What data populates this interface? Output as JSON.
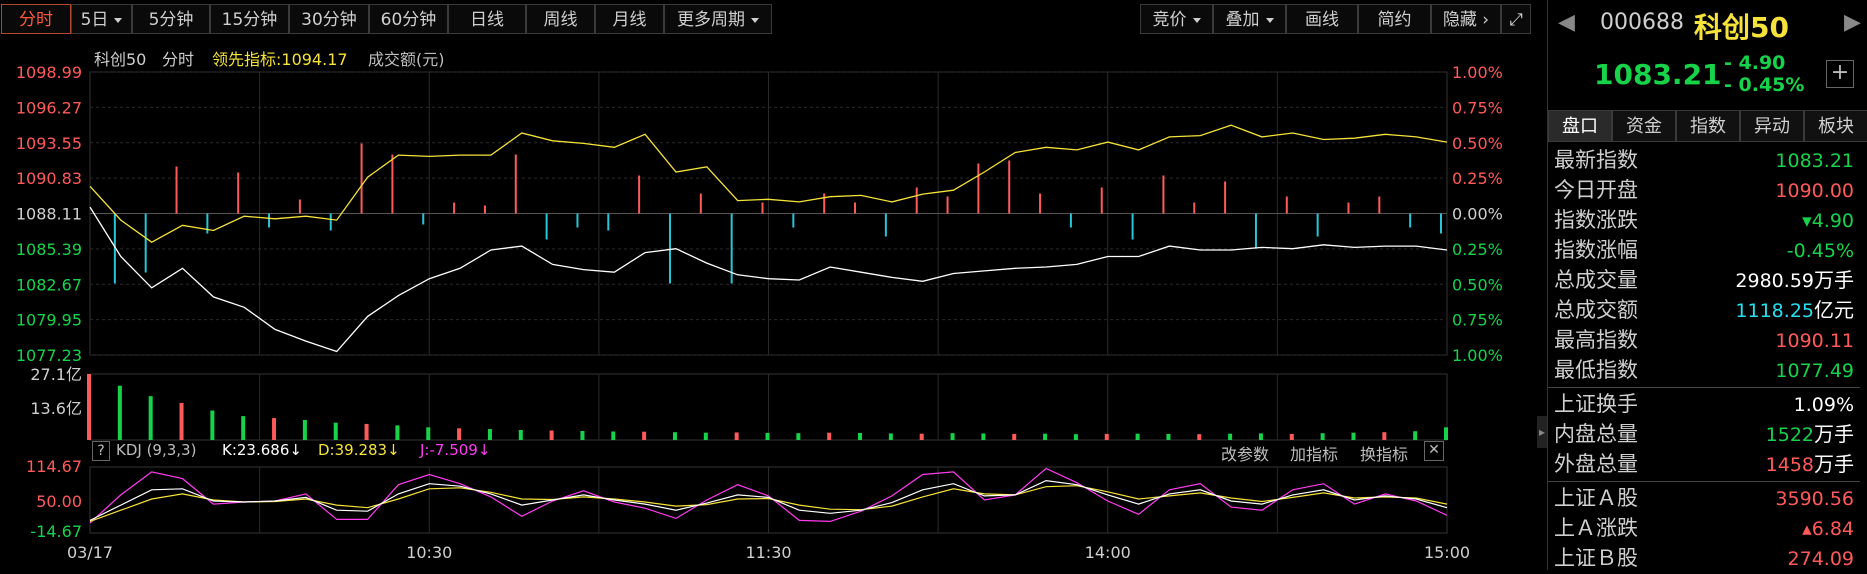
{
  "toolbar": {
    "tabs": [
      "分时",
      "5日",
      "5分钟",
      "15分钟",
      "30分钟",
      "60分钟",
      "日线",
      "周线",
      "月线",
      "更多周期"
    ],
    "right": [
      "竞价",
      "叠加",
      "画线",
      "简约",
      "隐藏"
    ]
  },
  "legend": {
    "name": "科创50",
    "period": "分时",
    "lead_label": "领先指标:1094.17",
    "amount_label": "成交额(元)"
  },
  "price_axis_left": [
    "1098.99",
    "1096.27",
    "1093.55",
    "1090.83",
    "1088.11",
    "1085.39",
    "1082.67",
    "1079.95",
    "1077.23"
  ],
  "price_axis_right": [
    "1.00%",
    "0.75%",
    "0.50%",
    "0.25%",
    "0.00%",
    "0.25%",
    "0.50%",
    "0.75%",
    "1.00%"
  ],
  "volume_axis": [
    "27.1亿",
    "13.6亿"
  ],
  "kdj": {
    "help": "?",
    "title": "KDJ (9,3,3)",
    "k": "K:23.686↓",
    "d": "D:39.283↓",
    "j": "J:-7.509↓",
    "buttons": [
      "改参数",
      "加指标",
      "换指标"
    ],
    "axis": [
      "114.67",
      "50.00",
      "-14.67"
    ]
  },
  "time_axis": [
    "03/17",
    "10:30",
    "11:30",
    "14:00",
    "15:00"
  ],
  "panel": {
    "code": "000688",
    "name": "科创50",
    "price": "1083.21",
    "change": "- 4.90",
    "change_pct": "- 0.45%",
    "tabs": [
      "盘口",
      "资金",
      "指数",
      "异动",
      "板块"
    ],
    "rows": [
      {
        "k": "最新指数",
        "v": "1083.21",
        "c": "green",
        "u": ""
      },
      {
        "k": "今日开盘",
        "v": "1090.00",
        "c": "red",
        "u": ""
      },
      {
        "k": "指数涨跌",
        "v": "▾4.90",
        "c": "green",
        "u": ""
      },
      {
        "k": "指数涨幅",
        "v": "-0.45%",
        "c": "green",
        "u": ""
      },
      {
        "k": "总成交量",
        "v": "2980.59",
        "c": "white",
        "u": "万手"
      },
      {
        "k": "总成交额",
        "v": "1118.25",
        "c": "cyan",
        "u": "亿元"
      },
      {
        "k": "最高指数",
        "v": "1090.11",
        "c": "red",
        "u": ""
      },
      {
        "k": "最低指数",
        "v": "1077.49",
        "c": "green",
        "u": ""
      },
      {
        "k": "上证换手",
        "v": "1.09%",
        "c": "white",
        "u": ""
      },
      {
        "k": "内盘总量",
        "v": "1522",
        "c": "green",
        "u": "万手"
      },
      {
        "k": "外盘总量",
        "v": "1458",
        "c": "red",
        "u": "万手"
      },
      {
        "k": "上证Ａ股",
        "v": "3590.56",
        "c": "red",
        "u": ""
      },
      {
        "k": "上Ａ涨跌",
        "v": "▴6.84",
        "c": "red",
        "u": ""
      },
      {
        "k": "上证Ｂ股",
        "v": "274.09",
        "c": "red",
        "u": ""
      }
    ]
  },
  "colors": {
    "up": "#ff5a5a",
    "down": "#17d34a",
    "lead": "#f5e23a",
    "price": "#ffffff",
    "bar_down": "#27c6d6",
    "k": "#ffffff",
    "d": "#f5e23a",
    "j": "#ff3cf0"
  },
  "chart_data": {
    "type": "line",
    "title": "",
    "xlabel": "",
    "ylabel": "",
    "x_ticks": [
      "03/17",
      "10:30",
      "11:30",
      "14:00",
      "15:00"
    ],
    "ylim": [
      1077.23,
      1098.99
    ],
    "series": [
      {
        "values": [
          1088.6,
          1084.8,
          1082.4,
          1083.9,
          1081.7,
          1080.9,
          1079.2,
          1078.3,
          1077.5,
          1080.2,
          1081.8,
          1083.1,
          1083.9,
          1085.3,
          1085.6,
          1084.2,
          1083.8,
          1083.6,
          1085.1,
          1085.4,
          1084.3,
          1083.4,
          1083.1,
          1083.0,
          1084.0,
          1083.6,
          1083.2,
          1082.9,
          1083.5,
          1083.7,
          1083.9,
          1084.0,
          1084.2,
          1084.8,
          1084.8,
          1085.6,
          1085.3,
          1085.3,
          1085.5,
          1085.4,
          1085.7,
          1085.5,
          1085.6,
          1085.6,
          1085.3
        ]
      },
      {
        "values": [
          1090.2,
          1087.6,
          1085.9,
          1087.2,
          1086.8,
          1087.9,
          1087.7,
          1087.9,
          1087.6,
          1090.9,
          1092.6,
          1092.5,
          1092.6,
          1092.6,
          1094.3,
          1093.7,
          1093.5,
          1093.2,
          1094.2,
          1091.3,
          1091.7,
          1089.1,
          1089.2,
          1089.0,
          1089.4,
          1089.5,
          1089.0,
          1089.6,
          1089.9,
          1091.3,
          1092.8,
          1093.2,
          1093.0,
          1093.6,
          1093.0,
          1094.0,
          1094.1,
          1094.9,
          1094.0,
          1094.3,
          1093.8,
          1093.9,
          1094.2,
          1094.0,
          1093.6
        ]
      }
    ],
    "volume": {
      "ylim": [
        0,
        27.1
      ],
      "values": [
        27.1,
        22.3,
        18.0,
        15.2,
        12.1,
        9.8,
        9.0,
        8.2,
        7.1,
        6.6,
        6.0,
        5.2,
        4.8,
        4.5,
        4.1,
        3.9,
        3.7,
        3.5,
        3.4,
        3.2,
        3.0,
        3.1,
        2.9,
        2.8,
        3.0,
        2.9,
        2.7,
        2.6,
        2.8,
        2.7,
        2.5,
        2.6,
        2.4,
        2.5,
        2.6,
        2.5,
        2.4,
        2.6,
        2.7,
        2.5,
        2.8,
        3.0,
        3.2,
        3.6,
        5.2
      ]
    },
    "kdj": {
      "ylim": [
        -14.67,
        114.67
      ],
      "k": [
        10,
        40,
        70,
        72,
        48,
        46,
        48,
        55,
        30,
        28,
        62,
        82,
        77,
        62,
        40,
        50,
        60,
        50,
        42,
        30,
        44,
        60,
        55,
        30,
        24,
        30,
        45,
        70,
        82,
        58,
        60,
        88,
        80,
        60,
        42,
        62,
        70,
        48,
        42,
        60,
        70,
        50,
        58,
        52,
        35
      ],
      "d": [
        8,
        30,
        52,
        62,
        50,
        46,
        47,
        52,
        40,
        35,
        52,
        72,
        74,
        65,
        52,
        51,
        56,
        52,
        46,
        38,
        41,
        52,
        53,
        40,
        32,
        31,
        38,
        56,
        72,
        62,
        60,
        76,
        78,
        66,
        52,
        58,
        64,
        54,
        47,
        55,
        64,
        54,
        56,
        54,
        42
      ],
      "j": [
        5,
        60,
        105,
        92,
        42,
        46,
        48,
        62,
        12,
        12,
        80,
        100,
        82,
        56,
        18,
        48,
        68,
        46,
        34,
        14,
        50,
        80,
        58,
        10,
        8,
        28,
        58,
        100,
        105,
        50,
        60,
        112,
        84,
        48,
        22,
        70,
        82,
        36,
        30,
        70,
        82,
        42,
        62,
        48,
        20
      ]
    }
  }
}
